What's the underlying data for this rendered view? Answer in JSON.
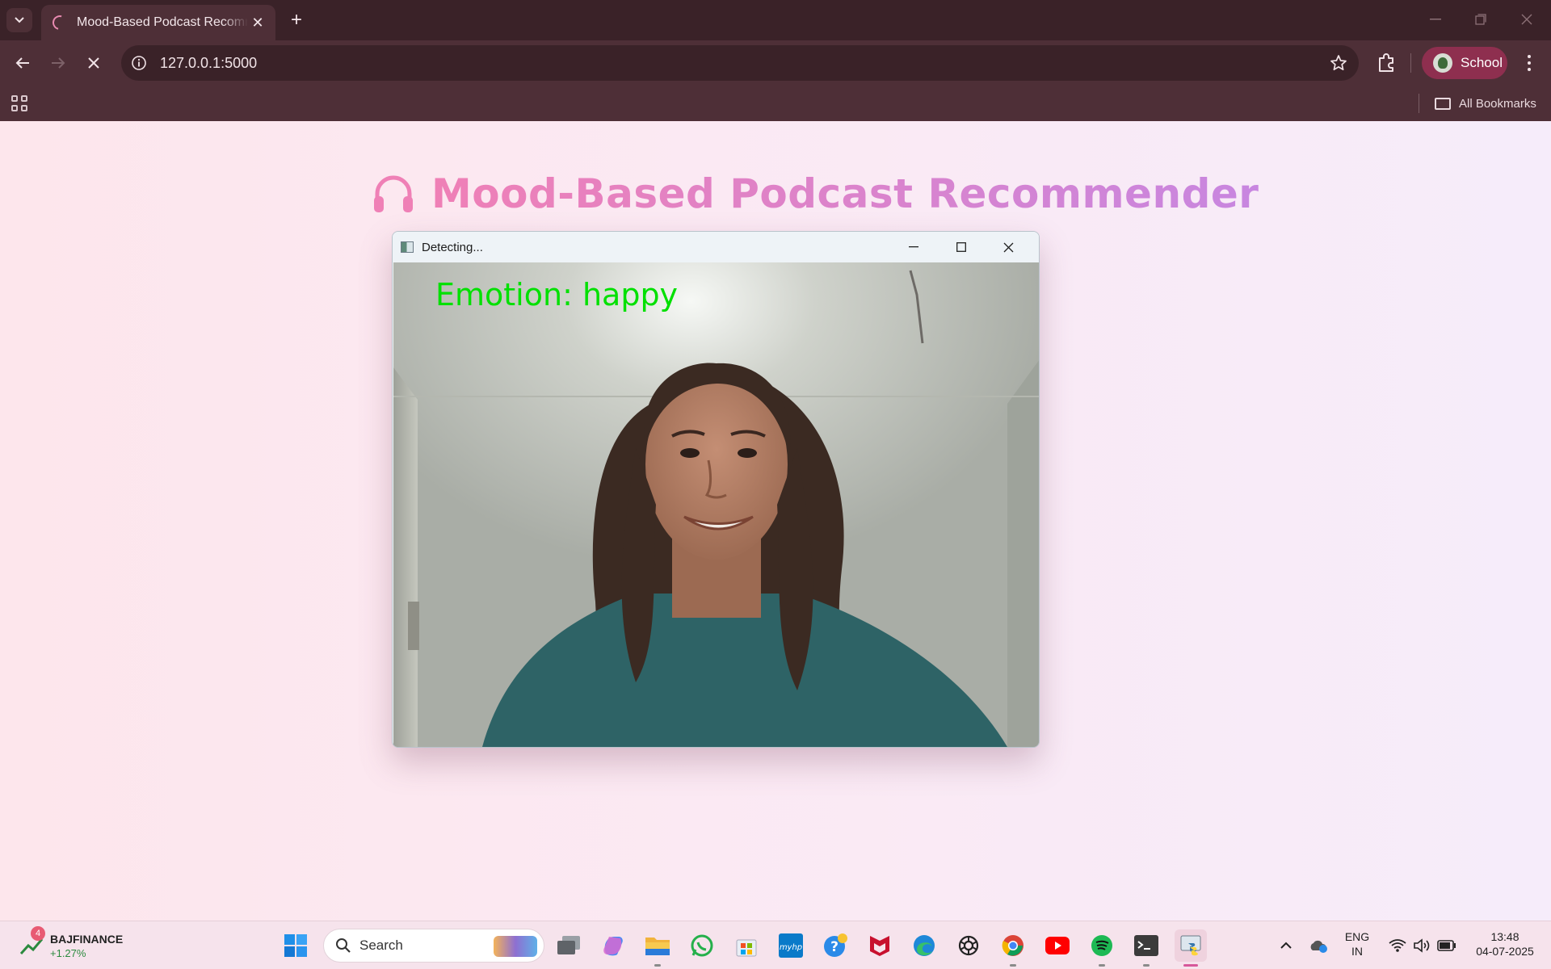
{
  "browser": {
    "tab_title": "Mood-Based Podcast Recommender",
    "address": "127.0.0.1:5000",
    "profile_label": "School",
    "bookmarks_label": "All Bookmarks",
    "icons": [
      "tab-search-icon",
      "loading-spinner-icon",
      "close-tab-icon",
      "new-tab-icon",
      "minimize-icon",
      "restore-icon",
      "close-window-icon",
      "back-icon",
      "forward-icon",
      "stop-loading-icon",
      "site-info-icon",
      "bookmark-star-icon",
      "extensions-icon",
      "menu-icon",
      "apps-icon",
      "folder-icon"
    ]
  },
  "page": {
    "title": "Mood-Based Podcast Recommender",
    "title_icon": "headphones-icon",
    "title_gradient": [
      "#ef80b6",
      "#c886e0"
    ]
  },
  "detector_window": {
    "title": "Detecting...",
    "overlay_text": "Emotion:  happy",
    "overlay_color": "#00e000"
  },
  "taskbar": {
    "stock_symbol": "BAJFINANCE",
    "stock_change": "+1.27%",
    "stock_badge": "4",
    "search_label": "Search",
    "apps": [
      "start-icon",
      "task-view-icon",
      "copilot-icon",
      "file-explorer-icon",
      "whatsapp-icon",
      "microsoft-store-icon",
      "myhp-icon",
      "get-help-icon",
      "mcafee-icon",
      "edge-icon",
      "chatgpt-icon",
      "chrome-icon",
      "youtube-icon",
      "spotify-icon",
      "terminal-icon",
      "python-icon"
    ],
    "language_top": "ENG",
    "language_bottom": "IN",
    "time": "13:48",
    "date": "04-07-2025"
  }
}
